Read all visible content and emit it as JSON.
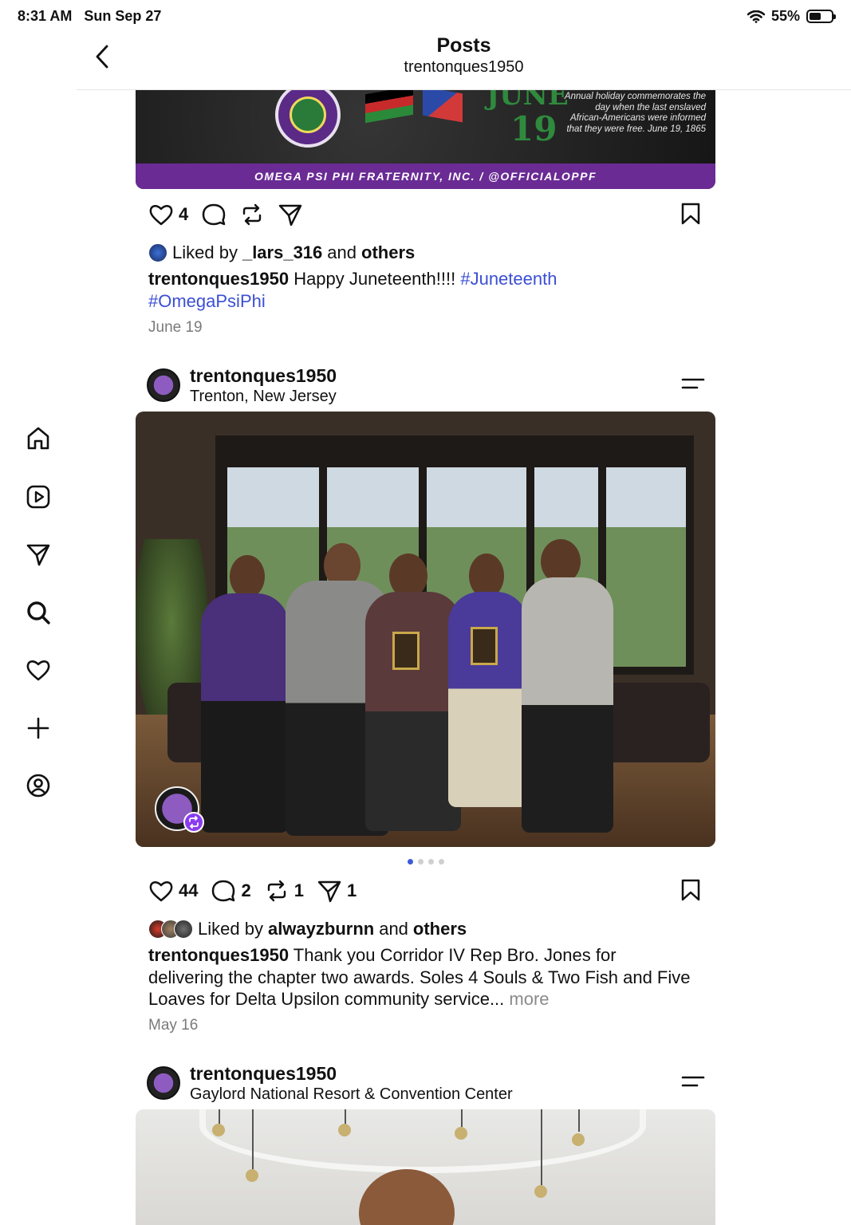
{
  "status_bar": {
    "time": "8:31 AM",
    "date": "Sun Sep 27",
    "battery": "55%",
    "battery_level": 0.55
  },
  "header": {
    "title": "Posts",
    "subtitle": "trentonques1950"
  },
  "nav": {
    "items": [
      {
        "icon": "home-icon"
      },
      {
        "icon": "reels-icon"
      },
      {
        "icon": "messages-icon"
      },
      {
        "icon": "search-icon"
      },
      {
        "icon": "activity-heart-icon"
      },
      {
        "icon": "create-plus-icon"
      },
      {
        "icon": "profile-icon"
      }
    ]
  },
  "post1": {
    "banner": {
      "june": "JUNE",
      "day": "19",
      "note": "Annual holiday commemorates the day when the last enslaved African-Americans were informed that they were free. June 19, 1865",
      "strip": "OMEGA PSI PHI FRATERNITY, INC. / @OFFICIALOPPF"
    },
    "like_count": "4",
    "liked_by_prefix": "Liked by",
    "liked_by_user": "_lars_316",
    "liked_by_and": "and",
    "liked_by_others": "others",
    "username": "trentonques1950",
    "caption_text": "Happy Juneteenth!!!!",
    "hashtag1": "#Juneteenth",
    "hashtag2": "#OmegaPsiPhi",
    "date": "June 19"
  },
  "post2": {
    "username": "trentonques1950",
    "location": "Trenton, New Jersey",
    "like_count": "44",
    "comment_count": "2",
    "repost_count": "1",
    "share_count": "1",
    "liked_by_prefix": "Liked by",
    "liked_by_user": "alwayzburnn",
    "liked_by_and": "and",
    "liked_by_others": "others",
    "caption_username": "trentonques1950",
    "caption_text": "Thank you Corridor IV Rep Bro. Jones for delivering the chapter two awards. Soles 4 Souls & Two Fish and Five Loaves for Delta Upsilon community service...",
    "more": "more",
    "date": "May 16",
    "carousel_pages": 4,
    "carousel_active": 1
  },
  "post3": {
    "username": "trentonques1950",
    "location": "Gaylord National Resort & Convention Center"
  },
  "colors": {
    "hashtag": "#3b4fd4",
    "brand_purple": "#6a2b94",
    "carousel_active": "#3b5bdb"
  }
}
